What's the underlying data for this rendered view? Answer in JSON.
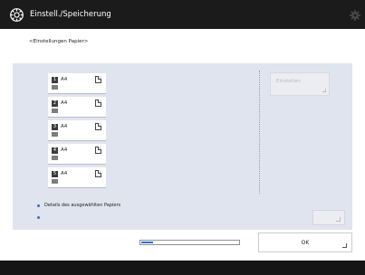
{
  "header": {
    "title": "Einstell./Speicherung",
    "app_icon": "gear-wrench-icon",
    "settings_icon": "gear-icon"
  },
  "subtitle": "<Einstellungen Papier>",
  "paper_sources": [
    {
      "number": "1",
      "size": "A4"
    },
    {
      "number": "2",
      "size": "A4"
    },
    {
      "number": "3",
      "size": "A4"
    },
    {
      "number": "4",
      "size": "A4"
    },
    {
      "number": "5",
      "size": "A4"
    }
  ],
  "settings_button": {
    "label": "Einstellen"
  },
  "details_link": "Details des ausgewählten Papiers",
  "ok_button": {
    "label": "OK"
  },
  "progress": {
    "percent": 12
  },
  "colors": {
    "accent": "#2f70dc",
    "header": "#1b1b1b",
    "panel": "#e0e4ee"
  }
}
